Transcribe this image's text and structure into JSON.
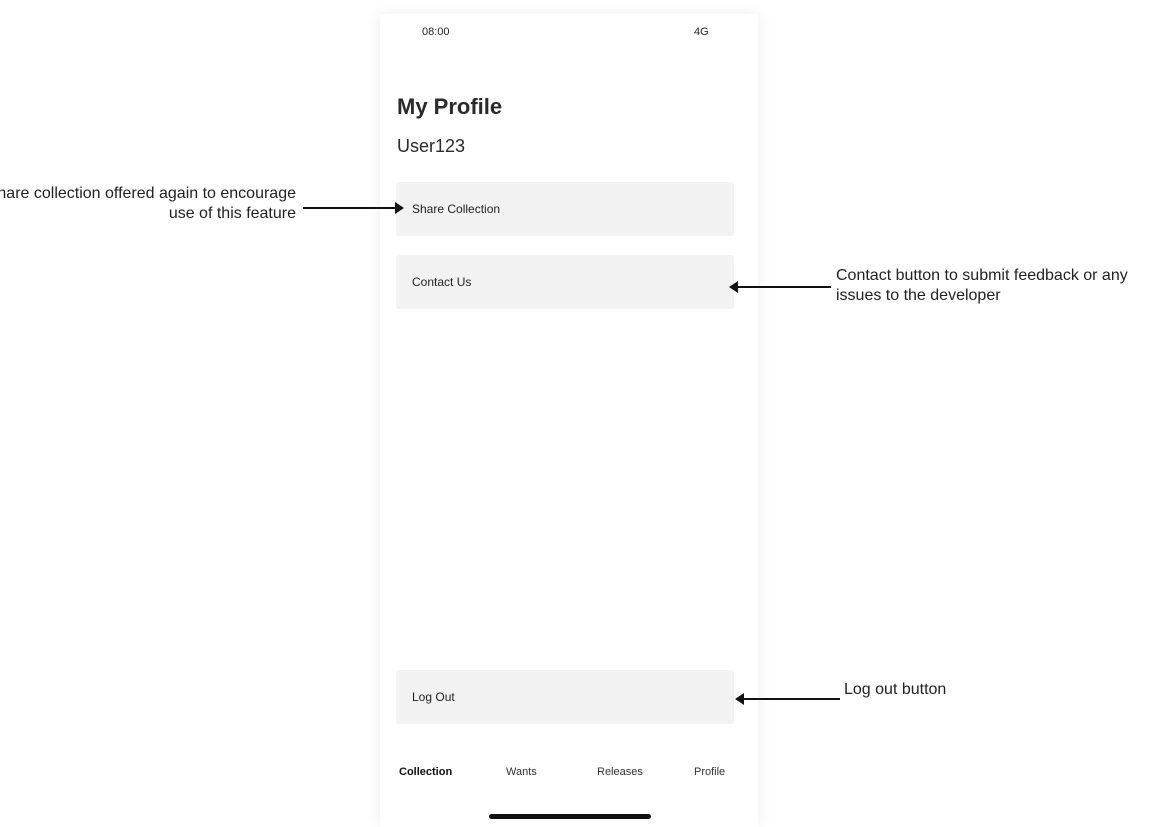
{
  "status_bar": {
    "time": "08:00",
    "network": "4G"
  },
  "profile": {
    "title": "My Profile",
    "username": "User123"
  },
  "buttons": {
    "share": "Share Collection",
    "contact": "Contact Us",
    "logout": "Log Out"
  },
  "tabs": [
    {
      "label": "Collection",
      "active": true
    },
    {
      "label": "Wants",
      "active": false
    },
    {
      "label": "Releases",
      "active": false
    },
    {
      "label": "Profile",
      "active": false
    }
  ],
  "annotations": {
    "share": "Share collection offered again to encourage use of this feature",
    "contact": "Contact button to submit feedback or any issues to the developer",
    "logout": "Log out button"
  },
  "colors": {
    "button_bg": "#f2f2f2",
    "text": "#222222",
    "home_indicator": "#111111"
  }
}
